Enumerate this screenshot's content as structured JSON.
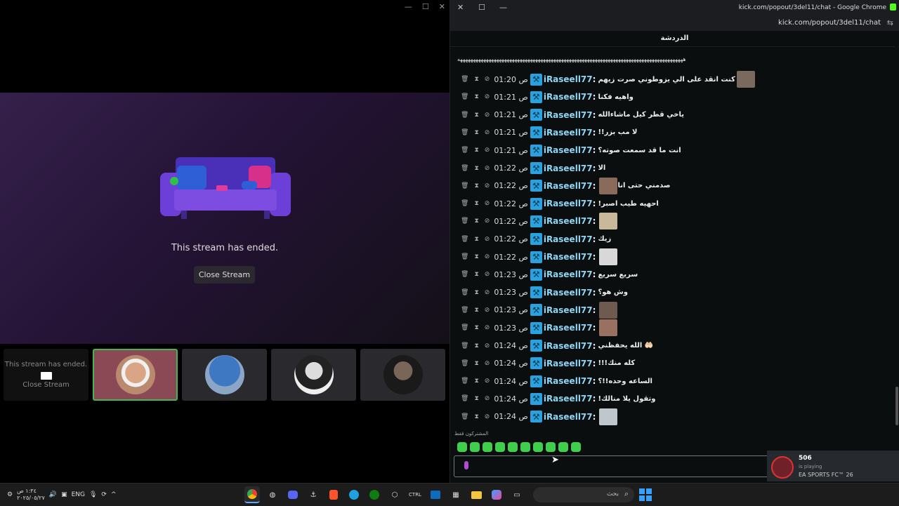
{
  "stream": {
    "ended_message": "This stream has ended.",
    "close_button": "Close Stream"
  },
  "thumbnails": [
    {
      "title": "This stream has ended.",
      "button": "Close Stream"
    },
    {
      "avatar": "person-avatar",
      "color": "#b98a6e",
      "selected": true
    },
    {
      "avatar": "group-avatar",
      "color": "#3f78c2"
    },
    {
      "avatar": "man-suit-avatar",
      "color": "#777777"
    },
    {
      "avatar": "dark-portrait-avatar",
      "color": "#4a3c32"
    }
  ],
  "chrome": {
    "title": "kick.com/popout/3del11/chat - Google Chrome",
    "url": "kick.com/popout/3del11/chat"
  },
  "chat": {
    "header": "الدردشة",
    "laugh_line": "هههههههههههههههههههههههههههههههههههههههههههههههههههههههههههههههههههههههههههههههههههههههه",
    "messages": [
      {
        "time": "01:20 ص",
        "user": "iRaseell77",
        "text": "كنت انقد على الي يزوطوني صرت زيهم",
        "emote": "#7a6a5e",
        "emote_pos": "start"
      },
      {
        "time": "01:21 ص",
        "user": "iRaseell77",
        "text": "واهيه فكنا"
      },
      {
        "time": "01:21 ص",
        "user": "iRaseell77",
        "text": "ياخي قطر كيل ماشاءالله"
      },
      {
        "time": "01:21 ص",
        "user": "iRaseell77",
        "text": "!!لا مب بزر"
      },
      {
        "time": "01:21 ص",
        "user": "iRaseell77",
        "text": "انت ما قد سمعت صوته؟"
      },
      {
        "time": "01:22 ص",
        "user": "iRaseell77",
        "text": "الا"
      },
      {
        "time": "01:22 ص",
        "user": "iRaseell77",
        "text": "صدمني حتى انا",
        "emote": "#8a6a5a"
      },
      {
        "time": "01:22 ص",
        "user": "iRaseell77",
        "text": "!احهيه طيب اصبر"
      },
      {
        "time": "01:22 ص",
        "user": "iRaseell77",
        "text": "",
        "emote": "#c9b99a"
      },
      {
        "time": "01:22 ص",
        "user": "iRaseell77",
        "text": "زيك"
      },
      {
        "time": "01:22 ص",
        "user": "iRaseell77",
        "text": "",
        "emote": "#d8d8d8"
      },
      {
        "time": "01:23 ص",
        "user": "iRaseell77",
        "text": "سريع سريع"
      },
      {
        "time": "01:23 ص",
        "user": "iRaseell77",
        "text": "وش هو؟"
      },
      {
        "time": "01:23 ص",
        "user": "iRaseell77",
        "text": "",
        "emote": "#6e5a4e"
      },
      {
        "time": "01:23 ص",
        "user": "iRaseell77",
        "text": "",
        "emote": "#9a7060"
      },
      {
        "time": "01:24 ص",
        "user": "iRaseell77",
        "text": "الله يحفظني 🤲🏻"
      },
      {
        "time": "01:24 ص",
        "user": "iRaseell77",
        "text": "!!!كله منك"
      },
      {
        "time": "01:24 ص",
        "user": "iRaseell77",
        "text": "الساعه وحده!!؟"
      },
      {
        "time": "01:24 ص",
        "user": "iRaseell77",
        "text": "!وتقول يلا منالك"
      },
      {
        "time": "01:24 ص",
        "user": "iRaseell77",
        "text": "",
        "emote": "#bfc6cc"
      }
    ],
    "sub_only": "المشتركون فقط",
    "emote_count": 10
  },
  "toast": {
    "count": "506",
    "playing": "is playing",
    "game": "EA SPORTS FC™ 26"
  },
  "taskbar": {
    "clock_time": "١:٣٤ ص",
    "clock_date": "٢٠٢٥/٠٥/٢٧",
    "lang": "ENG",
    "search_placeholder": "بحث"
  }
}
